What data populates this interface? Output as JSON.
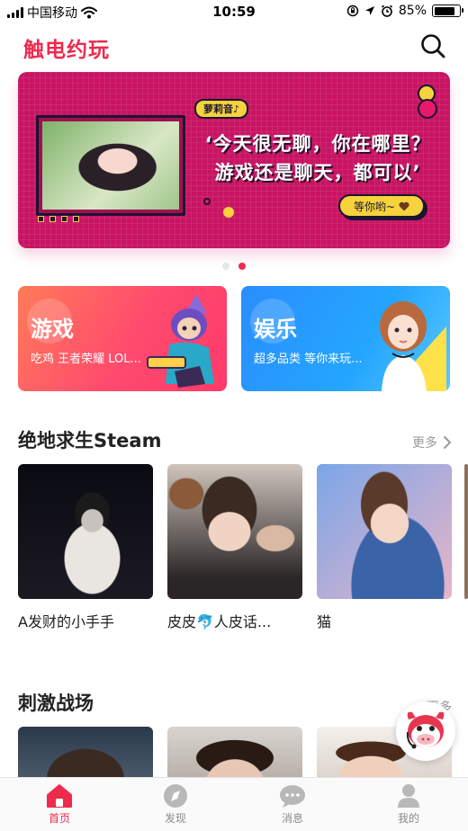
{
  "status_bar": {
    "carrier": "中国移动",
    "time": "10:59",
    "battery": "85%",
    "battery_level": 0.85,
    "icons": [
      "signal-icon",
      "wifi-icon",
      "orientation-lock-icon",
      "location-icon",
      "alarm-icon",
      "battery-icon"
    ]
  },
  "header": {
    "title": "触电约玩",
    "search_icon": "search-icon"
  },
  "banner": {
    "tag": "萝莉音♪",
    "line1": "‘今天很无聊，你在哪里？",
    "line2": "游戏还是聊天，都可以’",
    "cta": "等你哟~",
    "cta_icon": "heart-icon",
    "page_count": 2,
    "active_page": 2
  },
  "categories": [
    {
      "title": "游戏",
      "subtitle": "吃鸡 王者荣耀 LOL..."
    },
    {
      "title": "娱乐",
      "subtitle": "超多品类 等你来玩..."
    }
  ],
  "sections": [
    {
      "title": "绝地求生Steam",
      "more": "更多",
      "items": [
        {
          "name": "A发财的小手手"
        },
        {
          "name": "皮皮🐬人皮话..."
        },
        {
          "name": "猫"
        }
      ]
    },
    {
      "title": "刺激战场",
      "more": "更多"
    }
  ],
  "tabbar": [
    {
      "label": "首页",
      "icon": "home-icon",
      "active": true
    },
    {
      "label": "发现",
      "icon": "compass-icon",
      "active": false
    },
    {
      "label": "消息",
      "icon": "chat-icon",
      "active": false
    },
    {
      "label": "我的",
      "icon": "profile-icon",
      "active": false
    }
  ],
  "colors": {
    "accent": "#ee2a4d",
    "banner_bg": "#c81463",
    "banner_yellow": "#f6d23c",
    "games_card": "#ff4a6e",
    "entertainment_card": "#24a6ff",
    "tab_inactive": "#b8b8b8"
  }
}
